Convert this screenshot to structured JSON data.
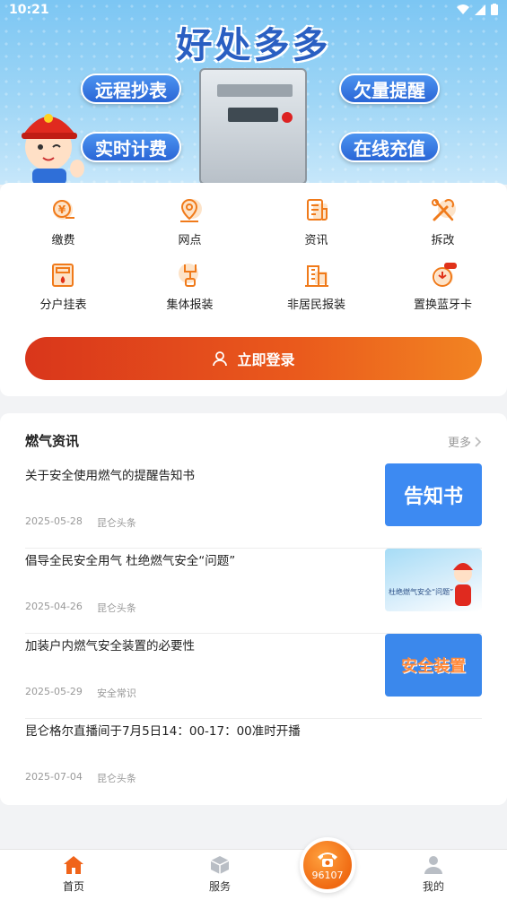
{
  "status_bar": {
    "time": "10:21"
  },
  "hero": {
    "title": "好处多多",
    "tags": [
      "远程抄表",
      "实时计费",
      "欠量提醒",
      "在线充值"
    ]
  },
  "services": [
    {
      "label": "缴费",
      "icon": "payment-icon"
    },
    {
      "label": "网点",
      "icon": "location-pin-icon"
    },
    {
      "label": "资讯",
      "icon": "news-icon"
    },
    {
      "label": "拆改",
      "icon": "tools-icon"
    },
    {
      "label": "分户挂表",
      "icon": "meter-icon"
    },
    {
      "label": "集体报装",
      "icon": "pipe-icon"
    },
    {
      "label": "非居民报装",
      "icon": "building-icon"
    },
    {
      "label": "置换蓝牙卡",
      "icon": "bluetooth-card-icon"
    }
  ],
  "login_button": {
    "label": "立即登录"
  },
  "news": {
    "heading": "燃气资讯",
    "more_label": "更多",
    "items": [
      {
        "title": "关于安全使用燃气的提醒告知书",
        "date": "2025-05-28",
        "source": "昆仑头条",
        "thumb_text": "告知书"
      },
      {
        "title": "倡导全民安全用气 杜绝燃气安全“问题”",
        "date": "2025-04-26",
        "source": "昆仑头条",
        "thumb_text": "杜绝燃气安全“问题”"
      },
      {
        "title": "加装户内燃气安全装置的必要性",
        "date": "2025-05-29",
        "source": "安全常识",
        "thumb_text": "安全装置"
      },
      {
        "title": "昆仑格尔直播间于7月5日14：00-17：00准时开播",
        "date": "2025-07-04",
        "source": "昆仑头条"
      }
    ]
  },
  "bottom_nav": {
    "home": "首页",
    "service": "服务",
    "hotline": "96107",
    "mine": "我的"
  },
  "colors": {
    "accent": "#ee5a1c",
    "hero_blue": "#2a5fc2"
  }
}
